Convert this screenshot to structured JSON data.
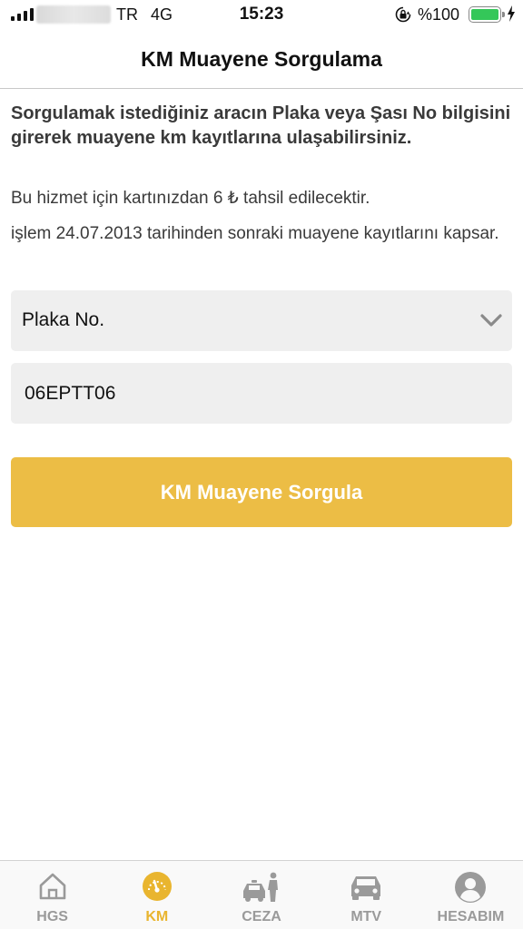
{
  "status_bar": {
    "carrier": "TR",
    "network": "4G",
    "time": "15:23",
    "battery": "%100",
    "battery_color": "#34c759"
  },
  "header": {
    "title": "KM Muayene Sorgulama"
  },
  "content": {
    "intro_text": "Sorgulamak istediğiniz aracın Plaka veya Şası No bilgisini girerek muayene km kayıtlarına ulaşabilirsiniz.",
    "fee_text": "Bu hizmet için kartınızdan 6 ₺ tahsil edilecektir.",
    "scope_text": "işlem 24.07.2013 tarihinden sonraki muayene kayıtlarını kapsar."
  },
  "form": {
    "query_type": {
      "selected": "Plaka No.",
      "icon": "chevron-down-icon"
    },
    "plate_input": {
      "value": "06EPTT06"
    },
    "submit_label": "KM Muayene Sorgula",
    "submit_color": "#ecbd45"
  },
  "tab_bar": {
    "active_color": "#e9b52f",
    "inactive_color": "#9a9a9a",
    "items": [
      {
        "label": "HGS",
        "icon": "home-icon",
        "active": false
      },
      {
        "label": "KM",
        "icon": "speedometer-icon",
        "active": true
      },
      {
        "label": "CEZA",
        "icon": "police-car-icon",
        "active": false
      },
      {
        "label": "MTV",
        "icon": "car-icon",
        "active": false
      },
      {
        "label": "HESABIM",
        "icon": "user-icon",
        "active": false
      }
    ]
  }
}
